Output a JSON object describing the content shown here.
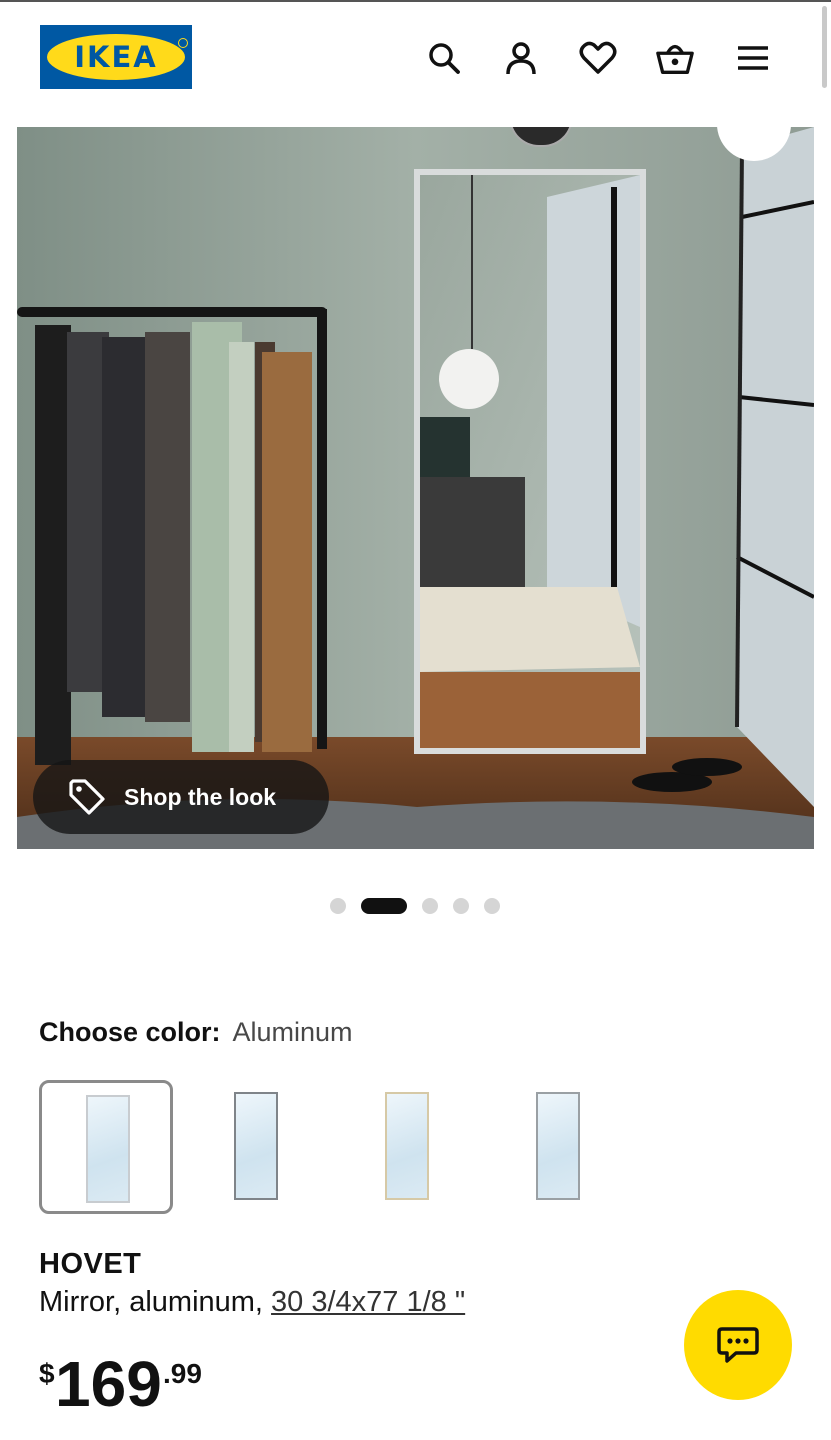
{
  "header": {
    "logo_text": "IKEA",
    "icons": [
      "search-icon",
      "account-icon",
      "heart-icon",
      "basket-icon",
      "menu-icon"
    ]
  },
  "hero": {
    "shop_the_look_label": "Shop the look",
    "slides_total": 5,
    "active_slide": 2
  },
  "product": {
    "choose_color_label": "Choose color:",
    "selected_color": "Aluminum",
    "swatches": [
      {
        "frame_color": "#c8ccd0",
        "selected": true
      },
      {
        "frame_color": "#7f8489",
        "selected": false
      },
      {
        "frame_color": "#d6c9a6",
        "selected": false
      },
      {
        "frame_color": "#9aa0a4",
        "selected": false
      }
    ],
    "name": "HOVET",
    "description": "Mirror, aluminum, ",
    "size": "30 3/4x77 1/8 \"",
    "price": {
      "currency": "$",
      "integer": "169",
      "decimal": ".99"
    }
  },
  "colors": {
    "brand_blue": "#0058a3",
    "brand_yellow": "#ffda1a",
    "chat_yellow": "#ffdb00"
  }
}
